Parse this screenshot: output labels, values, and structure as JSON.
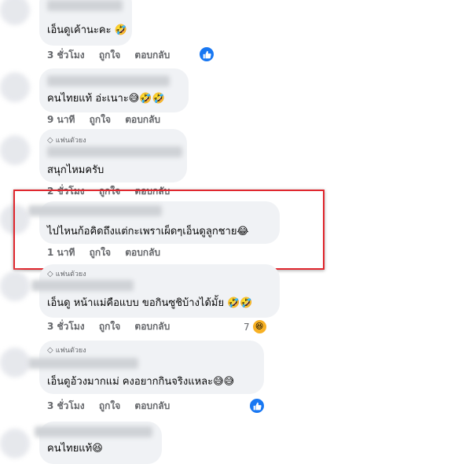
{
  "comments": [
    {
      "badge": "",
      "text": "เอ็นดูเค้านะคะ 🤣",
      "time": "3 ชั่วโมง",
      "like_label": "ถูกใจ",
      "reply_label": "ตอบกลับ",
      "reaction": "like",
      "reaction_count": ""
    },
    {
      "badge": "",
      "text": "คนไทยแท้ อ่ะเนาะ😅🤣🤣",
      "time": "9 นาที",
      "like_label": "ถูกใจ",
      "reply_label": "ตอบกลับ",
      "reaction": "",
      "reaction_count": ""
    },
    {
      "badge": "แฟนตัวยง",
      "text": "สนุกไหมครับ",
      "time": "2 ชั่วโมง",
      "like_label": "ถูกใจ",
      "reply_label": "ตอบกลับ",
      "reaction": "",
      "reaction_count": ""
    },
    {
      "badge": "",
      "text": "ไปไหนก้อคิดถึงแต่กะเพราเผ็ดๆเอ็นดูลูกชาย😂",
      "time": "1 นาที",
      "like_label": "ถูกใจ",
      "reply_label": "ตอบกลับ",
      "reaction": "",
      "reaction_count": ""
    },
    {
      "badge": "แฟนตัวยง",
      "text": "เอ็นดู หน้าแม่คือแบบ ขอกินซูชิบ้างได้มั้ย 🤣🤣",
      "time": "3 ชั่วโมง",
      "like_label": "ถูกใจ",
      "reply_label": "ตอบกลับ",
      "reaction": "haha",
      "reaction_count": "7"
    },
    {
      "badge": "แฟนตัวยง",
      "text": "เอ็นดูอ้วงมากแม่ คงอยากกินจริงแหละ😅😅",
      "time": "3 ชั่วโมง",
      "like_label": "ถูกใจ",
      "reply_label": "ตอบกลับ",
      "reaction": "like",
      "reaction_count": ""
    },
    {
      "badge": "",
      "text": "คนไทยแท้😆",
      "time": "",
      "like_label": "",
      "reply_label": "",
      "reaction": "",
      "reaction_count": ""
    }
  ],
  "icons": {
    "like": "thumbs-up-icon",
    "haha": "laughing-face-icon",
    "badge": "diamond-icon"
  },
  "colors": {
    "bubble": "#f0f2f5",
    "meta_text": "#65676b",
    "like_blue": "#1877f2",
    "highlight_red": "#e0272e"
  }
}
